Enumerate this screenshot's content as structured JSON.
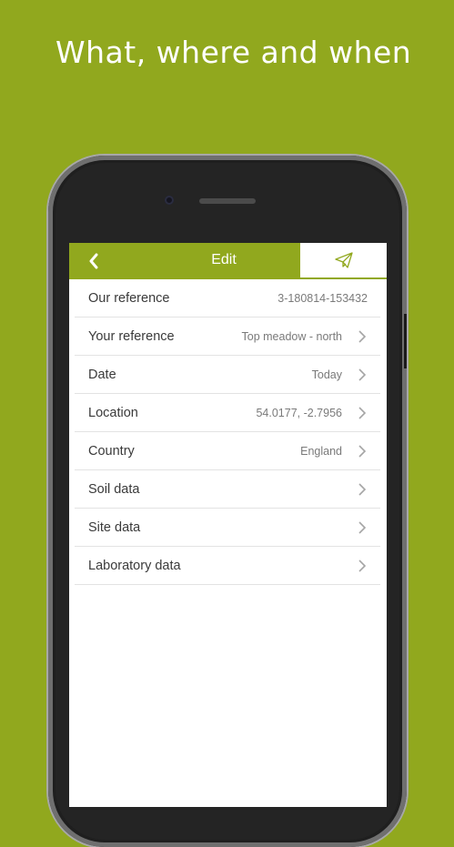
{
  "headline": "What, where and when",
  "nav": {
    "title": "Edit",
    "back_icon": "chevron-left-icon",
    "send_icon": "paper-plane-icon"
  },
  "rows": [
    {
      "label": "Our reference",
      "value": "3-180814-153432",
      "chevron": false
    },
    {
      "label": "Your reference",
      "value": "Top meadow - north",
      "chevron": true
    },
    {
      "label": "Date",
      "value": "Today",
      "chevron": true
    },
    {
      "label": "Location",
      "value": "54.0177, -2.7956",
      "chevron": true
    },
    {
      "label": "Country",
      "value": "England",
      "chevron": true
    },
    {
      "label": "Soil data",
      "value": "",
      "chevron": true
    },
    {
      "label": "Site data",
      "value": "",
      "chevron": true
    },
    {
      "label": "Laboratory data",
      "value": "",
      "chevron": true
    }
  ],
  "colors": {
    "brand_green": "#91a81e",
    "text": "#3a3a3a",
    "secondary_text": "#7a7a7a",
    "divider": "#e3e3e3"
  }
}
